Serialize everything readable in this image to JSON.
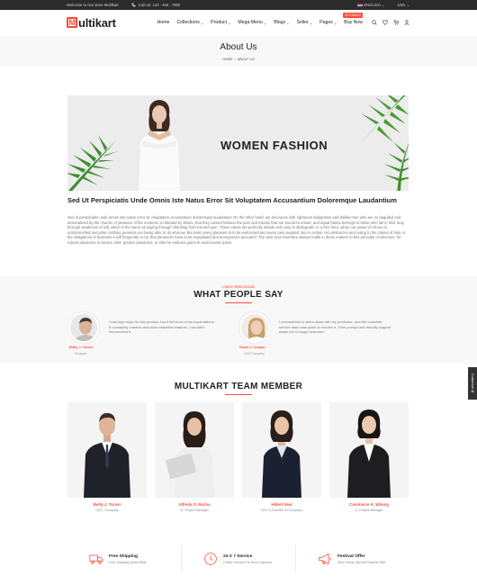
{
  "topbar": {
    "welcome": "Welcome to Our store Multikart",
    "phone": "Call Us: 123 - 456 - 7890",
    "language": "ENGLISH",
    "currency": "USD"
  },
  "header": {
    "logo_letter": "M",
    "logo_rest": "ultikart",
    "nav": [
      {
        "label": "Home",
        "chevron": false
      },
      {
        "label": "Collections",
        "chevron": true
      },
      {
        "label": "Product",
        "chevron": true
      },
      {
        "label": "Mega Menu",
        "chevron": true
      },
      {
        "label": "Blogs",
        "chevron": true
      },
      {
        "label": "Seller",
        "chevron": true
      },
      {
        "label": "Pages",
        "chevron": true
      }
    ],
    "buy_label": "Buy Now",
    "buy_badge": "25 THEMES"
  },
  "page_header": {
    "title": "About Us",
    "crumb_home": "HOME",
    "crumb_sep": "/",
    "crumb_current": "ABOUT US"
  },
  "banner": {
    "text": "WOMEN FASHION"
  },
  "about": {
    "title": "Sed Ut Perspiciatis Unde Omnis Iste Natus Error Sit Voluptatem Accusantium Doloremque Laudantium",
    "body": "Sed ut perspiciatis unde omnis iste natus error sit voluptatem accusantium doloremque laudantium On the other hand, we denounce with righteous indignation and dislike men who are so beguiled and demoralized by the charms of pleasure of the moment, so blinded by desire, that they cannot foresee the pain and trouble that are bound to ensue; and equal blame belongs to those who fail in their duty through weakness of will, which is the same as saying through shrinking from toil and pain. These cases are perfectly simple and easy to distinguish. In a free hour, when our power of choice is untrammelled and when nothing prevents our being able to do what we like best, every pleasure is to be welcomed and every pain avoided. But in certain circumstances and owing to the claims of duty or the obligations of business it will frequently occur that pleasures have to be repudiated and annoyances accepted. The wise man therefore always holds in these matters to this principle of selection: he rejects pleasures to secure other greater pleasures, or else he endures pains to avoid worse pains."
  },
  "testimonials": {
    "subtitle": "Latest Testimonials",
    "title": "WHAT PEOPLE SAY",
    "items": [
      {
        "name": "Betty J. Turner",
        "role": "Designer",
        "quote": "I had high hope for this product, but it fell short of my expectations. It constantly crashes and lacks essential features. I wouldn't recommend it."
      },
      {
        "name": "Gwen J. Cooper",
        "role": "CEO Company",
        "quote": "I encountered a minor issue with my purchase, and the customer service team was quick to resolve it. Their prompt and friendly support made me a happy customer!"
      }
    ]
  },
  "team": {
    "title": "MULTIKART TEAM MEMBER",
    "members": [
      {
        "name": "Betty J. Turner",
        "role": "CEO, Company"
      },
      {
        "name": "Alfreda S. Rocha",
        "role": "Sr. Project Manager"
      },
      {
        "name": "Hibert Neal",
        "role": "CEO & Founder At Company"
      },
      {
        "name": "Constance K. Whang",
        "role": "Jr. Project Manager"
      }
    ]
  },
  "services": [
    {
      "title": "Free Shipping",
      "desc": "Free Shipping World Wide",
      "icon": "truck-icon"
    },
    {
      "title": "24 X 7 Service",
      "desc": "Online Service For New Customer",
      "icon": "clock-icon"
    },
    {
      "title": "Festival Offer",
      "desc": "New Online Special Festival Offer",
      "icon": "megaphone-icon"
    }
  ],
  "side_tab": {
    "label": "Customize"
  },
  "colors": {
    "accent": "#ff4c3b",
    "topbar": "#2b2b2b"
  }
}
